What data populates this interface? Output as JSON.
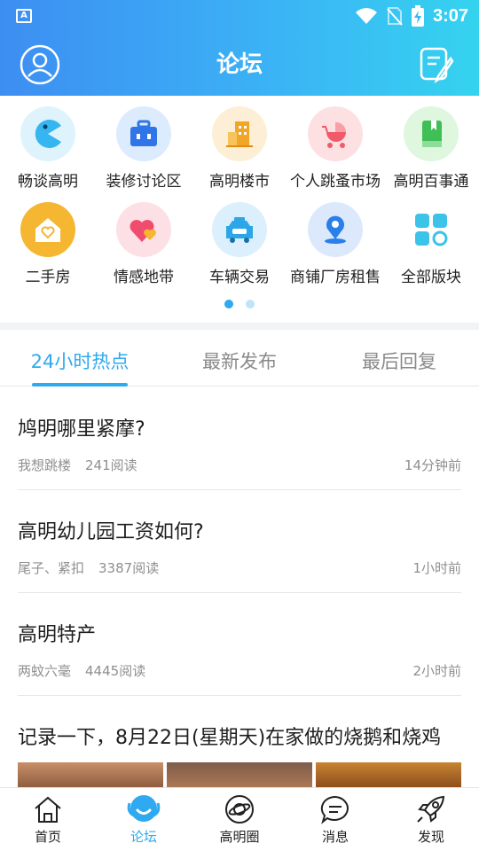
{
  "status_bar": {
    "time": "3:07",
    "app_badge": "A"
  },
  "app_bar": {
    "title": "论坛"
  },
  "categories": [
    {
      "label": "畅谈高明",
      "icon": "pacman-icon",
      "color": "#35b6f0"
    },
    {
      "label": "装修讨论区",
      "icon": "toolbox-icon",
      "color": "#2f74e8"
    },
    {
      "label": "高明楼市",
      "icon": "building-icon",
      "color": "#f2a626"
    },
    {
      "label": "个人跳蚤市场",
      "icon": "stroller-icon",
      "color": "#f05a6a"
    },
    {
      "label": "高明百事通",
      "icon": "book-icon",
      "color": "#3fbf55"
    },
    {
      "label": "二手房",
      "icon": "house-heart-icon",
      "color": "#f5b632"
    },
    {
      "label": "情感地带",
      "icon": "hearts-icon",
      "color": "#f04d6e"
    },
    {
      "label": "车辆交易",
      "icon": "car-icon",
      "color": "#2da6e8"
    },
    {
      "label": "商铺厂房租售",
      "icon": "location-pin-icon",
      "color": "#2a7fea"
    },
    {
      "label": "全部版块",
      "icon": "grid-icon",
      "color": "#3cc3e8"
    }
  ],
  "pager": {
    "active_index": 0,
    "count": 2
  },
  "tabs": [
    {
      "label": "24小时热点",
      "active": true
    },
    {
      "label": "最新发布",
      "active": false
    },
    {
      "label": "最后回复",
      "active": false
    }
  ],
  "posts": [
    {
      "title": "鸠明哪里紧摩?",
      "author": "我想跳楼",
      "reads": "241阅读",
      "time": "14分钟前"
    },
    {
      "title": "高明幼儿园工资如何?",
      "author": "尾子、紧扣",
      "reads": "3387阅读",
      "time": "1小时前"
    },
    {
      "title": "高明特产",
      "author": "两蚊六毫",
      "reads": "4445阅读",
      "time": "2小时前"
    },
    {
      "title": "记录一下，8月22日(星期天)在家做的烧鹅和烧鸡",
      "author": "",
      "reads": "",
      "time": ""
    }
  ],
  "bottom_nav": [
    {
      "label": "首页",
      "icon": "home-icon",
      "active": false
    },
    {
      "label": "论坛",
      "icon": "forum-icon",
      "active": true
    },
    {
      "label": "高明圈",
      "icon": "planet-icon",
      "active": false
    },
    {
      "label": "消息",
      "icon": "message-icon",
      "active": false
    },
    {
      "label": "发现",
      "icon": "rocket-icon",
      "active": false
    }
  ],
  "colors": {
    "accent": "#2fa9ef",
    "header_start": "#3d8ef2",
    "header_end": "#35d3ef"
  }
}
